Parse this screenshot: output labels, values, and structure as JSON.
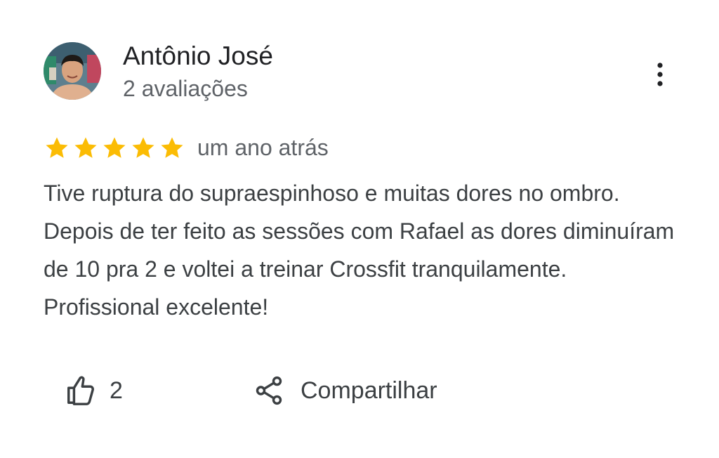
{
  "review": {
    "author": {
      "name": "Antônio José",
      "reviews_count": "2 avaliações",
      "avatar": "profile-photo"
    },
    "menu_icon": "more-vert-icon",
    "rating": 5,
    "rating_max": 5,
    "star_icon": "star-icon",
    "date": "um ano atrás",
    "text": "Tive ruptura do supraespinhoso e muitas dores no ombro. Depois de ter feito as sessões com Rafael as dores diminuíram de 10 pra 2 e voltei a treinar Crossfit tranquilamente. Profissional excelente!",
    "actions": {
      "like_icon": "thumb-up-icon",
      "like_count": "2",
      "share_icon": "share-icon",
      "share_label": "Compartilhar"
    }
  },
  "colors": {
    "star": "#fbbc04",
    "primary_text": "#202124",
    "secondary_text": "#5f6368",
    "body_text": "#3c4043"
  }
}
